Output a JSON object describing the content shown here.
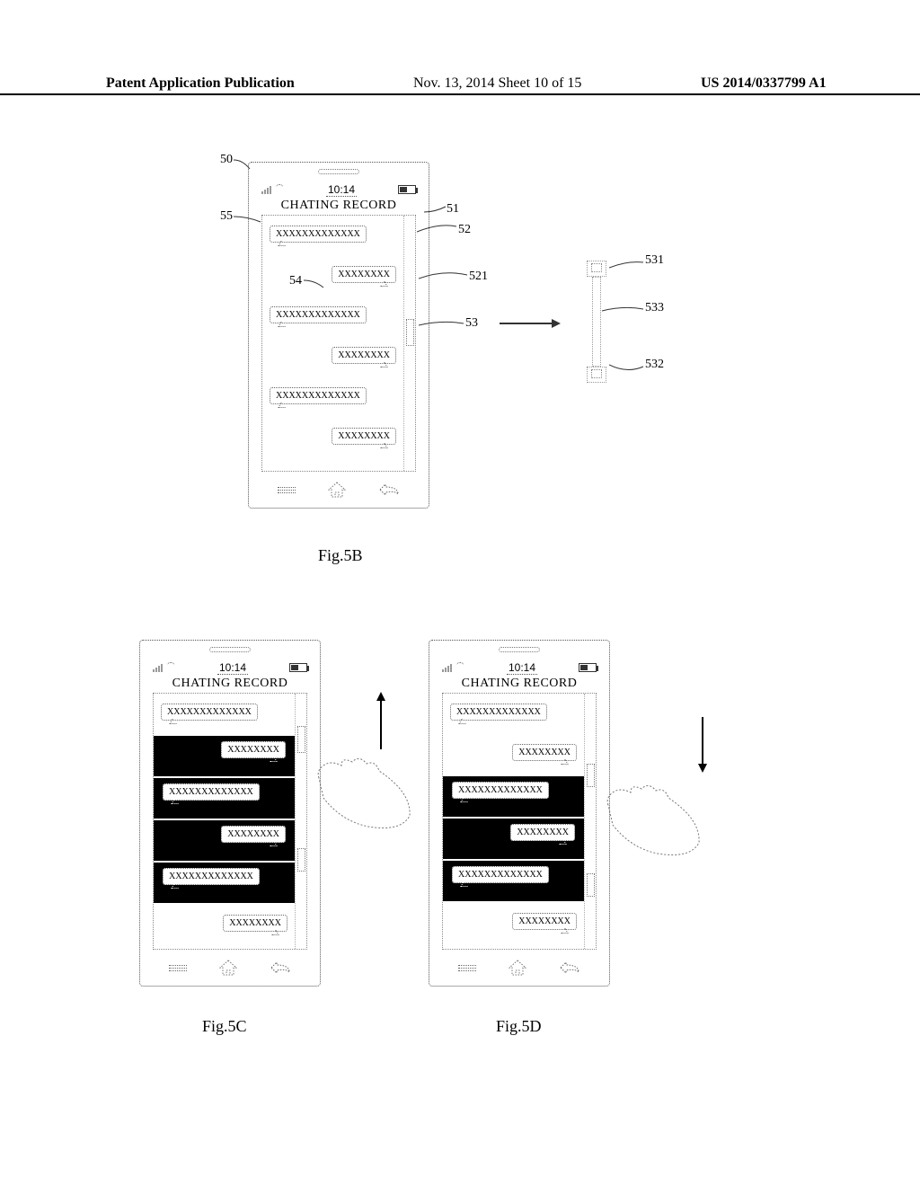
{
  "header": {
    "left": "Patent Application Publication",
    "mid": "Nov. 13, 2014  Sheet 10 of 15",
    "right": "US 2014/0337799 A1"
  },
  "common": {
    "status_time": "10:14",
    "screen_title": "CHATING RECORD",
    "msg_long": "XXXXXXXXXXXXX",
    "msg_short": "XXXXXXXX"
  },
  "fig5b": {
    "caption": "Fig.5B",
    "refs": {
      "r50": "50",
      "r51": "51",
      "r52": "52",
      "r521": "521",
      "r53": "53",
      "r54": "54",
      "r55": "55",
      "r531": "531",
      "r532": "532",
      "r533": "533"
    }
  },
  "fig5c": {
    "caption": "Fig.5C"
  },
  "fig5d": {
    "caption": "Fig.5D"
  }
}
